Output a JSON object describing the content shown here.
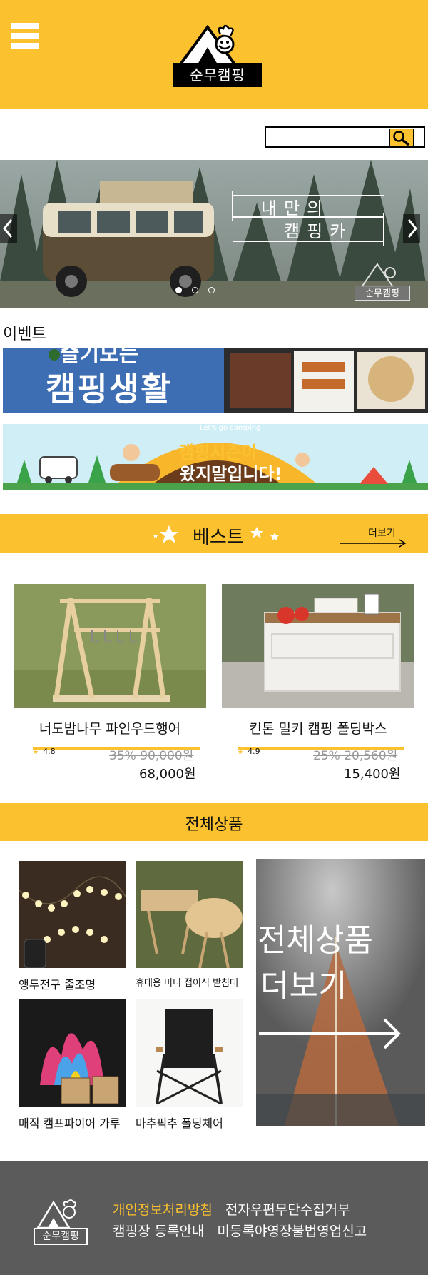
{
  "header": {
    "logo_text": "순무캠핑"
  },
  "search": {
    "placeholder": "",
    "button_icon": "search-icon"
  },
  "banner": {
    "title_line1": "내만의",
    "title_line2": "캠핑카",
    "logo_text": "순무캠핑",
    "slides": 3,
    "active_slide": 1
  },
  "event": {
    "label": "이벤트",
    "banner1_top": "즐기모든",
    "banner1_text": "캠핑생활",
    "banner2_small": "Let's go camping",
    "banner2_line1": "캠핑시즌이",
    "banner2_line2": "왔지말입니다!"
  },
  "best": {
    "title": "베스트",
    "more_label": "더보기",
    "products": [
      {
        "name": "너도밤나무 파인우드행어",
        "rating": "4.8",
        "old_price": "35% 90,000원",
        "price": "68,000원"
      },
      {
        "name": "킨톤 밀키 캠핑 폴딩박스",
        "rating": "4.9",
        "old_price": "25% 20,560원",
        "price": "15,400원"
      }
    ]
  },
  "all_products": {
    "title": "전체상품",
    "items": [
      {
        "label": "앵두전구 줄조명"
      },
      {
        "label": "휴대용 미니 접이식 받침대"
      },
      {
        "label": "매직 캠프파이어 가루"
      },
      {
        "label": "마추픽추 폴딩체어"
      }
    ],
    "more_line1": "전체상품",
    "more_line2": "더보기"
  },
  "footer": {
    "logo_text": "순무캠핑",
    "links": [
      "개인정보처리방침",
      "전자우편무단수집거부",
      "캠핑장 등록안내",
      "미등록야영장불법영업신고"
    ]
  },
  "colors": {
    "accent": "#fbc12e",
    "footer_bg": "#5b5b5b"
  }
}
